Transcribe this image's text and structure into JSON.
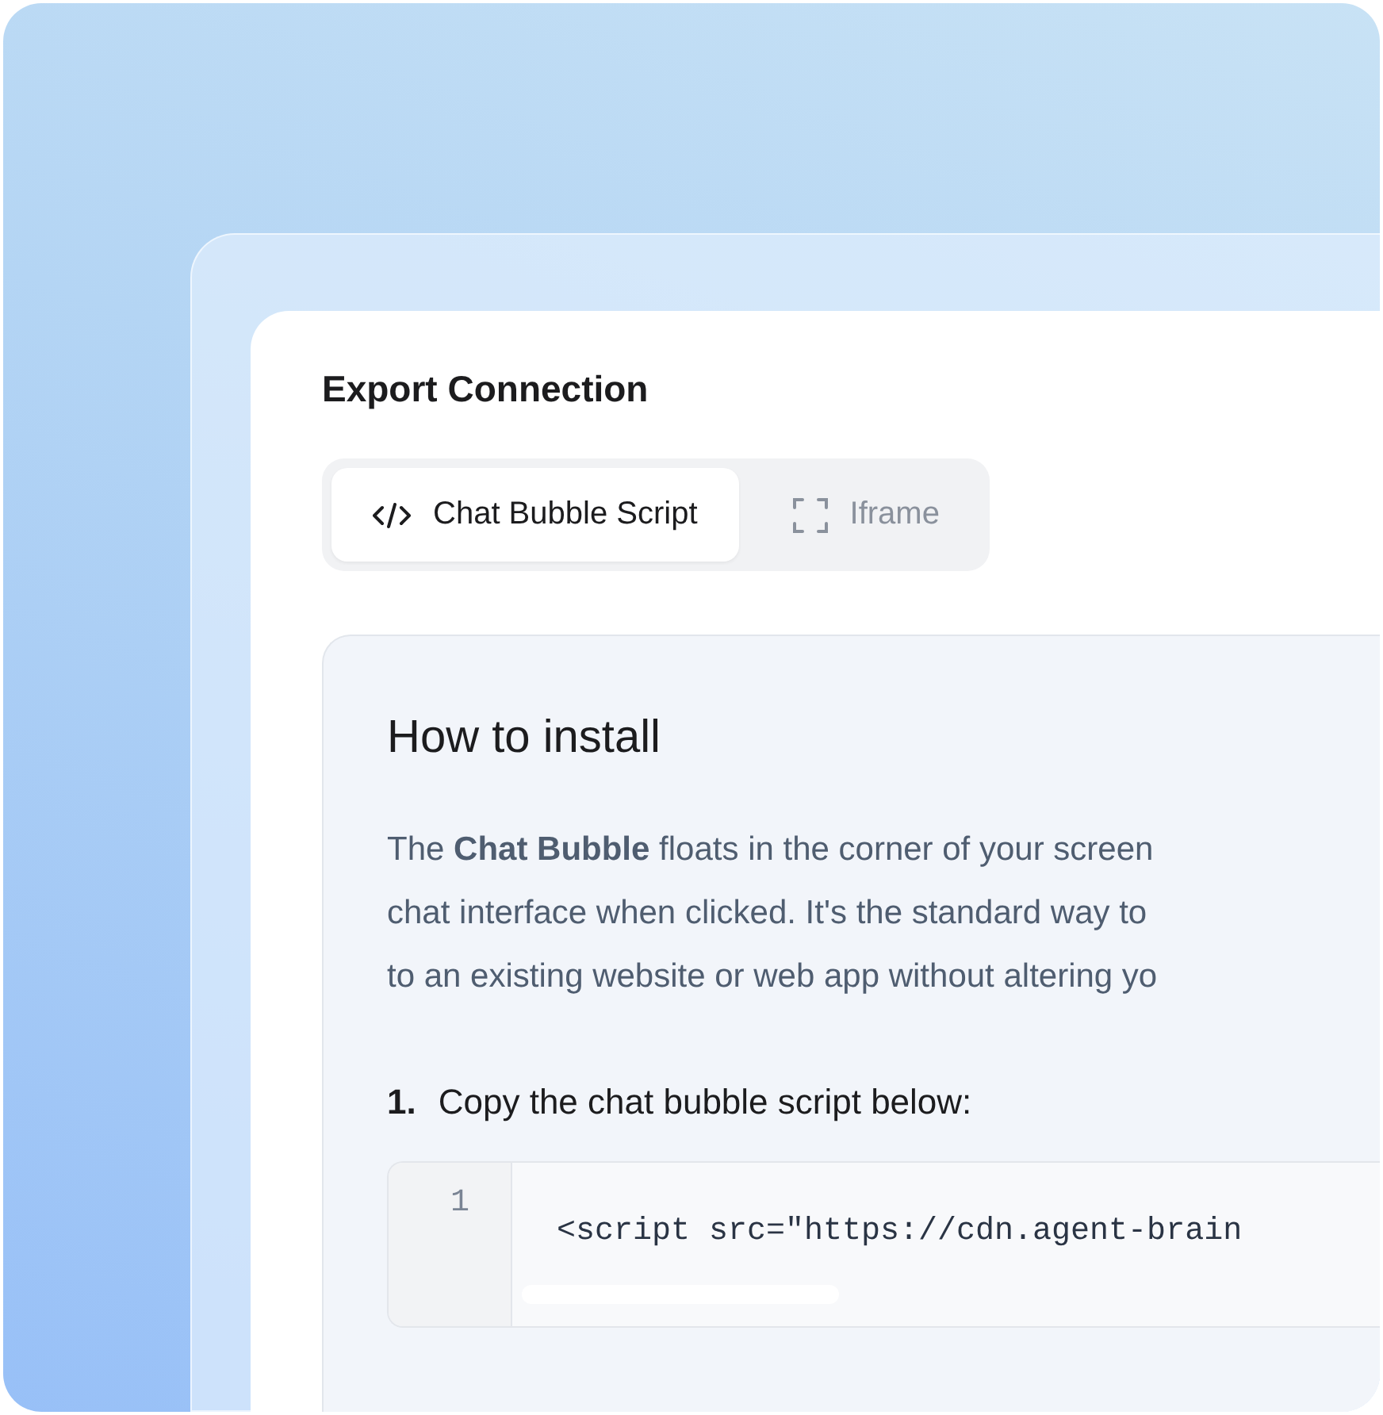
{
  "panel": {
    "title": "Export Connection"
  },
  "tabs": [
    {
      "label": "Chat Bubble Script",
      "kind": "code",
      "selected": true
    },
    {
      "label": "Iframe",
      "kind": "frame",
      "selected": false
    }
  ],
  "install": {
    "heading": "How to install",
    "paragraph_lines": [
      "The **Chat Bubble** floats in the corner of your screen",
      "chat interface when clicked. It's the standard way to",
      "to an existing website or web app without altering yo"
    ],
    "steps": [
      {
        "number": "1.",
        "text": "Copy the chat bubble script below:"
      }
    ],
    "code": {
      "lines": [
        {
          "number": "1",
          "text": "<script src=\"https://cdn.agent-brain"
        }
      ]
    }
  }
}
